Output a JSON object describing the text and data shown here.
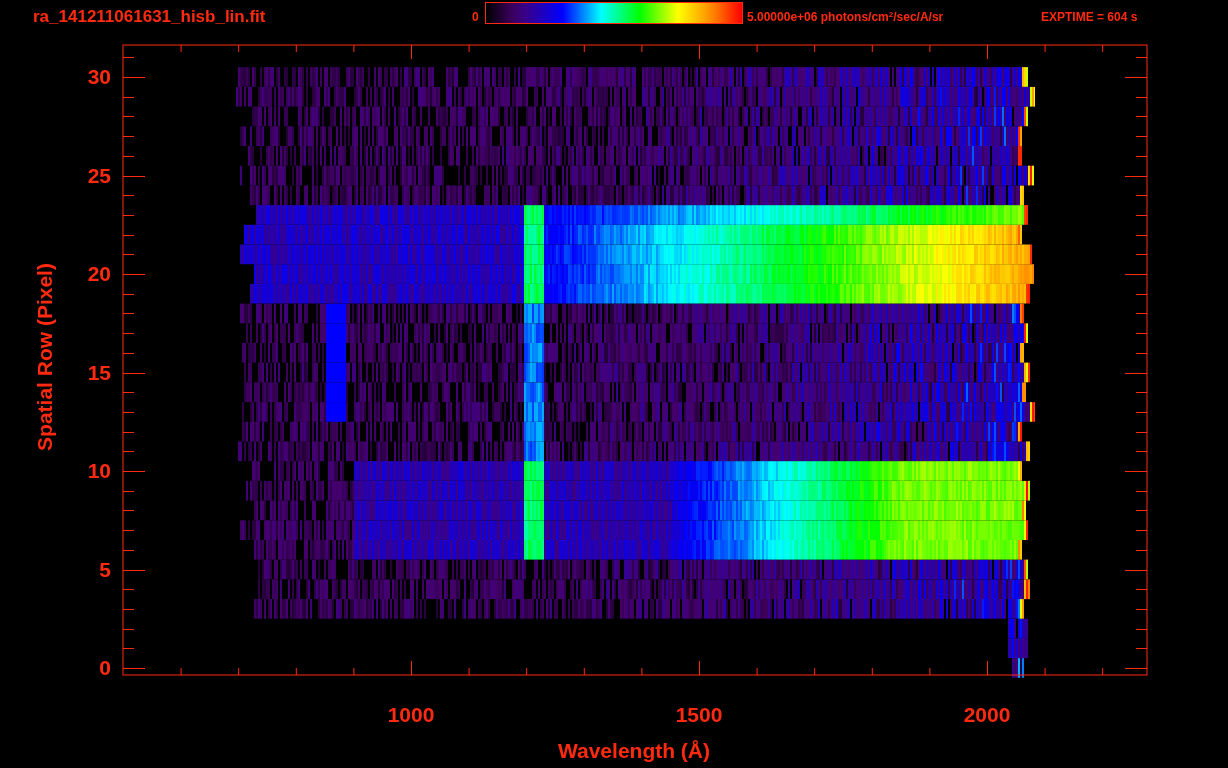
{
  "title": "ra_141211061631_hisb_lin.fit",
  "colorbar": {
    "min_label": "0",
    "max_label": "5.00000e+06 photons/cm$^{2}$/sec/A/sr"
  },
  "exptime": "EXPTIME = 604 s",
  "plot": {
    "ylabel": "Spatial Row (Pixel)",
    "xlabel": "Wavelength (Å)",
    "yticks": [
      "30",
      "25",
      "20",
      "15",
      "10",
      "5",
      "0"
    ],
    "xticks": [
      "1000",
      "1500",
      "2000"
    ]
  }
}
